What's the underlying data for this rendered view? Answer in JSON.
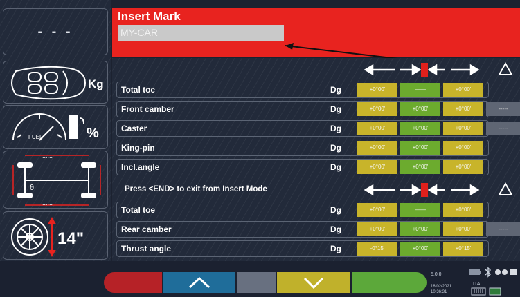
{
  "left_panel": {
    "placeholder_value": "- - -",
    "weight_unit": "Kg",
    "fuel_label": "FUEL",
    "fuel_unit": "%",
    "axle_dots_top": "......",
    "axle_dots_bottom": "......",
    "axle_angle_symbol": "θ",
    "rim_size": "14\""
  },
  "banner": {
    "title": "Insert Mark",
    "input_value": "MY-CAR"
  },
  "front_section": {
    "rows": [
      {
        "label": "Total toe",
        "unit": "Dg",
        "v1": "+0°00'",
        "v2": "——",
        "v3": "+0°00'",
        "v4": ""
      },
      {
        "label": "Front camber",
        "unit": "Dg",
        "v1": "+0°00'",
        "v2": "+0°00'",
        "v3": "+0°00'",
        "v4": "-----"
      },
      {
        "label": "Caster",
        "unit": "Dg",
        "v1": "+0°00'",
        "v2": "+0°00'",
        "v3": "+0°00'",
        "v4": "-----"
      },
      {
        "label": "King-pin",
        "unit": "Dg",
        "v1": "+0°00'",
        "v2": "+0°00'",
        "v3": "+0°00'",
        "v4": ""
      },
      {
        "label": "Incl.angle",
        "unit": "Dg",
        "v1": "+0°00'",
        "v2": "+0°00'",
        "v3": "+0°00'",
        "v4": ""
      }
    ]
  },
  "rear_section": {
    "message": "Press <END> to exit from Insert Mode",
    "rows": [
      {
        "label": "Total toe",
        "unit": "Dg",
        "v1": "+0°00'",
        "v2": "——",
        "v3": "+0°00'",
        "v4": ""
      },
      {
        "label": "Rear camber",
        "unit": "Dg",
        "v1": "+0°00'",
        "v2": "+0°00'",
        "v3": "+0°00'",
        "v4": "-----"
      },
      {
        "label": "Thrust angle",
        "unit": "Dg",
        "v1": "-0°15'",
        "v2": "+0°00'",
        "v3": "+0°15'",
        "v4": ""
      }
    ]
  },
  "status": {
    "version": "5.0.0",
    "date": "18/02/2021",
    "time": "10:36:31",
    "language": "ITA"
  },
  "colors": {
    "banner_red": "#e8231f",
    "tolerance_yellow": "#c8b42a",
    "value_green": "#6cab2e",
    "button_blue": "#1f6d9a"
  },
  "icons": [
    "car-weight-icon",
    "fuel-gauge-icon",
    "axle-diagram-icon",
    "wheel-rim-icon",
    "arrow-up-icon",
    "arrow-down-icon",
    "keyboard-icon",
    "battery-icon",
    "bluetooth-icon"
  ]
}
